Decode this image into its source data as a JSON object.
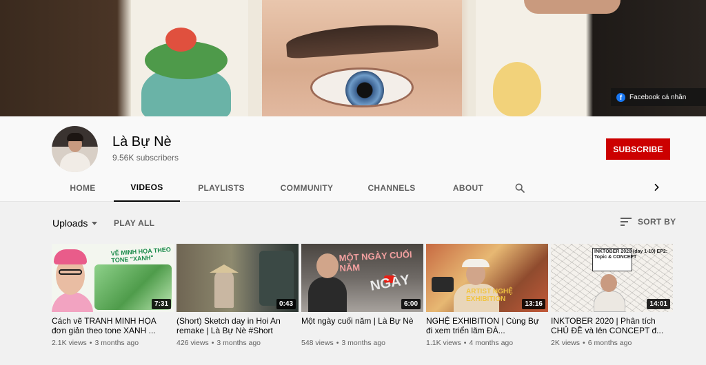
{
  "banner": {
    "social_link": {
      "icon": "facebook-icon",
      "label": "Facebook cá nhân"
    }
  },
  "channel": {
    "name": "Là Bự Nè",
    "subscribers": "9.56K subscribers",
    "subscribe_label": "SUBSCRIBE"
  },
  "tabs": [
    {
      "label": "HOME",
      "active": false
    },
    {
      "label": "VIDEOS",
      "active": true
    },
    {
      "label": "PLAYLISTS",
      "active": false
    },
    {
      "label": "COMMUNITY",
      "active": false
    },
    {
      "label": "CHANNELS",
      "active": false
    },
    {
      "label": "ABOUT",
      "active": false
    }
  ],
  "tab_icons": {
    "search": "search-icon",
    "next": "chevron-right-icon"
  },
  "controls": {
    "uploads_label": "Uploads",
    "play_all_label": "PLAY ALL",
    "sort_label": "SORT BY"
  },
  "videos": [
    {
      "duration": "7:31",
      "title": "Cách vẽ TRANH MINH HỌA đơn giản theo tone XANH ...",
      "views": "2.1K views",
      "age": "3 months ago",
      "thumb_text": "VẼ MINH HỌA THEO TONE \"XANH\""
    },
    {
      "duration": "0:43",
      "title": "(Short) Sketch day in Hoi An remake | Là Bự Nè #Short",
      "views": "426 views",
      "age": "3 months ago",
      "thumb_text": ""
    },
    {
      "duration": "6:00",
      "title": "Một ngày cuối năm | Là Bự Nè",
      "views": "548 views",
      "age": "3 months ago",
      "thumb_text": "MỘT NGÀY CUỐI NĂM",
      "thumb_text_2": "NGÀY"
    },
    {
      "duration": "13:16",
      "title": "NGHỆ EXHIBITION | Cùng Bự đi xem triển lãm ĐÀ...",
      "views": "1.1K views",
      "age": "4 months ago",
      "thumb_text": "ARTIST NGHỆ EXHIBITION"
    },
    {
      "duration": "14:01",
      "title": "INKTOBER 2020 | Phân tích CHỦ ĐỀ và lên CONCEPT đ...",
      "views": "2K views",
      "age": "6 months ago",
      "thumb_text": "INKTOBER 2020 (day 1-10) EP2: Topic & CONCEPT"
    }
  ]
}
